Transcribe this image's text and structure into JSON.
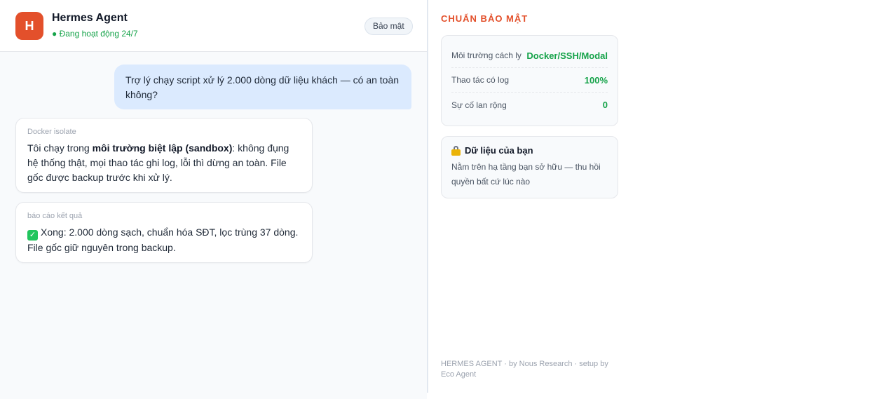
{
  "header": {
    "avatar_letter": "H",
    "agent_name": "Hermes Agent",
    "status": "● Đang hoạt động 24/7",
    "badge": "Bảo mật"
  },
  "messages": {
    "user": "Trợ lý chạy script xử lý 2.000 dòng dữ liệu khách — có an toàn không?",
    "bot1": {
      "tag": "Docker isolate",
      "text_before": "Tôi chạy trong ",
      "text_bold": "môi trường biệt lập (sandbox)",
      "text_after": ": không đụng hệ thống thật, mọi thao tác ghi log, lỗi thì dừng an toàn. File gốc được backup trước khi xử lý."
    },
    "bot2": {
      "tag": "báo cáo kết quả",
      "check_glyph": "✓",
      "text": "Xong: 2.000 dòng sạch, chuẩn hóa SĐT, lọc trùng 37 dòng. File gốc giữ nguyên trong backup."
    }
  },
  "side": {
    "title": "CHUẨN BẢO MẬT",
    "metrics": [
      {
        "label": "Môi trường cách ly",
        "value": "Docker/SSH/Modal"
      },
      {
        "label": "Thao tác có log",
        "value": "100%"
      },
      {
        "label": "Sự cố lan rộng",
        "value": "0"
      }
    ],
    "data_card": {
      "icon": "lock-icon",
      "title": "Dữ liệu của bạn",
      "text": "Nằm trên hạ tầng bạn sở hữu — thu hồi quyền bất cứ lúc nào"
    },
    "footer": "HERMES AGENT · by Nous Research · setup by Eco Agent"
  },
  "colors": {
    "accent": "#e3502b",
    "status_green": "#16a34a",
    "user_bubble": "#dbeafe"
  }
}
